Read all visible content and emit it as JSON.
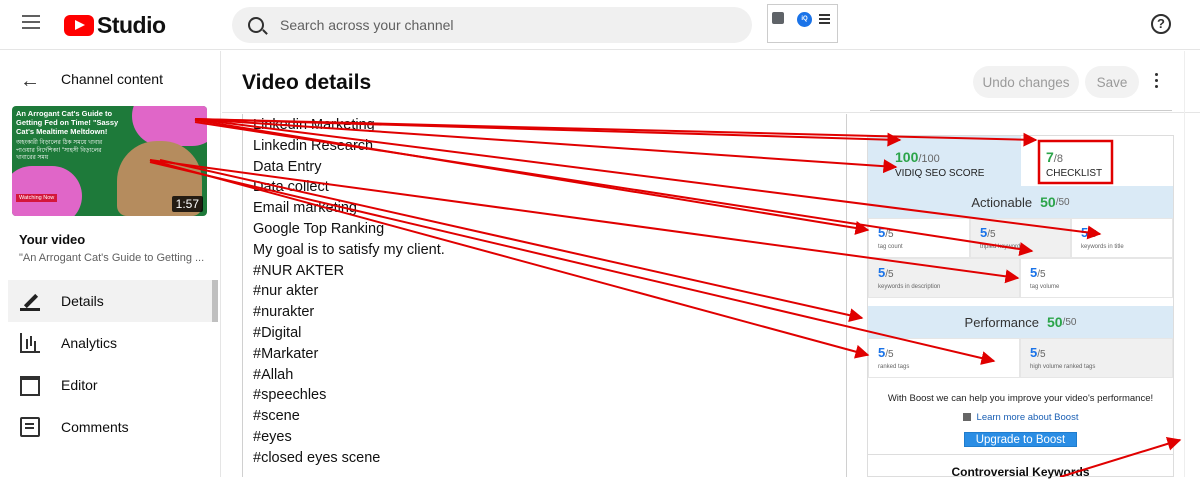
{
  "app": {
    "brand": "Studio"
  },
  "search": {
    "placeholder": "Search across your channel"
  },
  "extension": {
    "badge": "iQ"
  },
  "help": {
    "label": "?"
  },
  "sidebar": {
    "back_label": "Channel content",
    "thumbnail": {
      "title_text": "An Arrogant Cat's Guide to Getting Fed on Time! \"Sassy Cat's Mealtime Meltdown!",
      "sub_text": "অহংকারী বিড়ালের ঠিক সময়ে খাবার পাওয়ার নির্দেশিকা! \"সাহসী বিড়ালের খাবারের সময়",
      "watch_label": "Watching Now",
      "duration": "1:57"
    },
    "your_video_label": "Your video",
    "video_title": "\"An Arrogant Cat's Guide to Getting ...",
    "items": [
      {
        "label": "Details",
        "icon": "pencil-icon",
        "selected": true
      },
      {
        "label": "Analytics",
        "icon": "analytics-icon",
        "selected": false
      },
      {
        "label": "Editor",
        "icon": "editor-icon",
        "selected": false
      },
      {
        "label": "Comments",
        "icon": "comments-icon",
        "selected": false
      }
    ]
  },
  "header": {
    "title": "Video details",
    "undo_label": "Undo changes",
    "save_label": "Save"
  },
  "tags": [
    "Linkedin Marketing",
    "Linkedin Research",
    "Data Entry",
    "Data collect",
    "Email marketing",
    "Google Top Ranking",
    "My goal is to satisfy my client.",
    "#NUR AKTER",
    "#nur akter",
    "#nurakter",
    "#Digital",
    "#Markater",
    "#Allah",
    "#speechles",
    "#scene",
    "#eyes",
    "#closed eyes scene"
  ],
  "vidiq": {
    "seo_score": "100",
    "seo_max": "/100",
    "seo_label": "VIDIQ SEO SCORE",
    "checklist_score": "7",
    "checklist_max": "/8",
    "checklist_label": "CHECKLIST",
    "actionable": {
      "label": "Actionable",
      "score": "50",
      "max": "/50"
    },
    "actionable_cells": [
      {
        "value": "5",
        "max": "/5",
        "label": "tag count"
      },
      {
        "value": "5",
        "max": "/5",
        "label": "tripled keywords"
      },
      {
        "value": "5",
        "max": "/5",
        "label": "keywords in title"
      },
      {
        "value": "5",
        "max": "/5",
        "label": "keywords in description"
      },
      {
        "value": "5",
        "max": "/5",
        "label": "tag volume"
      }
    ],
    "performance": {
      "label": "Performance",
      "score": "50",
      "max": "/50"
    },
    "performance_cells": [
      {
        "value": "5",
        "max": "/5",
        "label": "ranked tags"
      },
      {
        "value": "5",
        "max": "/5",
        "label": "high volume ranked tags"
      }
    ],
    "boost_text": "With Boost we can help you improve your video's performance!",
    "learn_more": "Learn more about Boost",
    "upgrade_label": "Upgrade to Boost",
    "controversial_label": "Controversial Keywords"
  },
  "colors": {
    "annotation": "#e00000",
    "accent_green": "#2ba449",
    "accent_blue": "#1a73e8",
    "brand_red": "#ff0000"
  }
}
